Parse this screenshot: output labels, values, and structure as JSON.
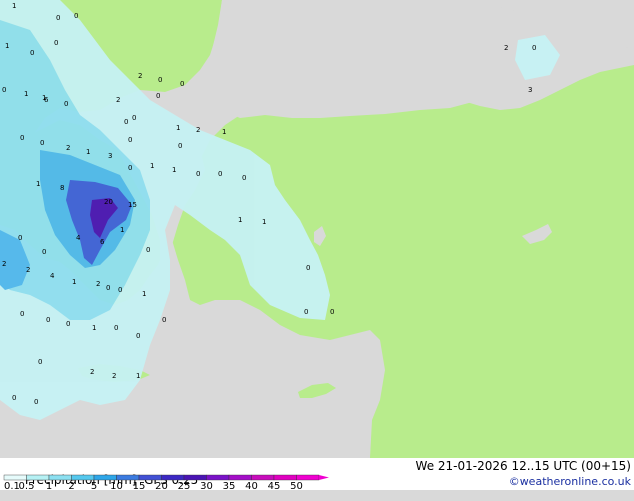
{
  "header": {
    "title": "Precipitation [mm]",
    "model": "GFS 0.25",
    "datetime": "We 21-01-2026 12..15 UTC (00+15)"
  },
  "credit": "©weatheronline.co.uk",
  "legend": {
    "ticks": [
      "0.1",
      "0.5",
      "1",
      "2",
      "5",
      "10",
      "15",
      "20",
      "25",
      "30",
      "35",
      "40",
      "45",
      "50"
    ],
    "colors": [
      "#e6fbfb",
      "#b6f1f4",
      "#8ce0f1",
      "#55c8ee",
      "#2ea6e8",
      "#3b7be0",
      "#4250d4",
      "#3c28c4",
      "#4a14b4",
      "#7a12c8",
      "#a40ec8",
      "#c80cbc",
      "#e000c0",
      "#f000d0"
    ]
  },
  "map_colors": {
    "sea": "#d9d9d9",
    "land": "#b8ec8c",
    "precip_light": "#c6f2f4",
    "precip_mid": "#8fdff0",
    "precip_heavy": "#4fb8ec",
    "precip_core": "#3e5fd8"
  },
  "station_values": [
    "1",
    "0",
    "0",
    "1",
    "0",
    "0",
    "2",
    "0",
    "1",
    "0",
    "1",
    "2",
    "0",
    "0",
    "0",
    "0",
    "1",
    "2",
    "1",
    "0",
    "0",
    "0",
    "0",
    "0",
    "0",
    "0",
    "2",
    "3",
    "6",
    "2",
    "1",
    "3",
    "1",
    "1",
    "0",
    "0",
    "0",
    "8",
    "20",
    "15",
    "1",
    "1",
    "4",
    "6",
    "0",
    "2",
    "2",
    "4",
    "1",
    "0",
    "0",
    "1",
    "2",
    "0",
    "0",
    "0",
    "1",
    "0",
    "0",
    "0",
    "0",
    "0",
    "1",
    "2",
    "2",
    "1",
    "0",
    "0",
    "0",
    "0",
    "1",
    "0",
    "0"
  ]
}
